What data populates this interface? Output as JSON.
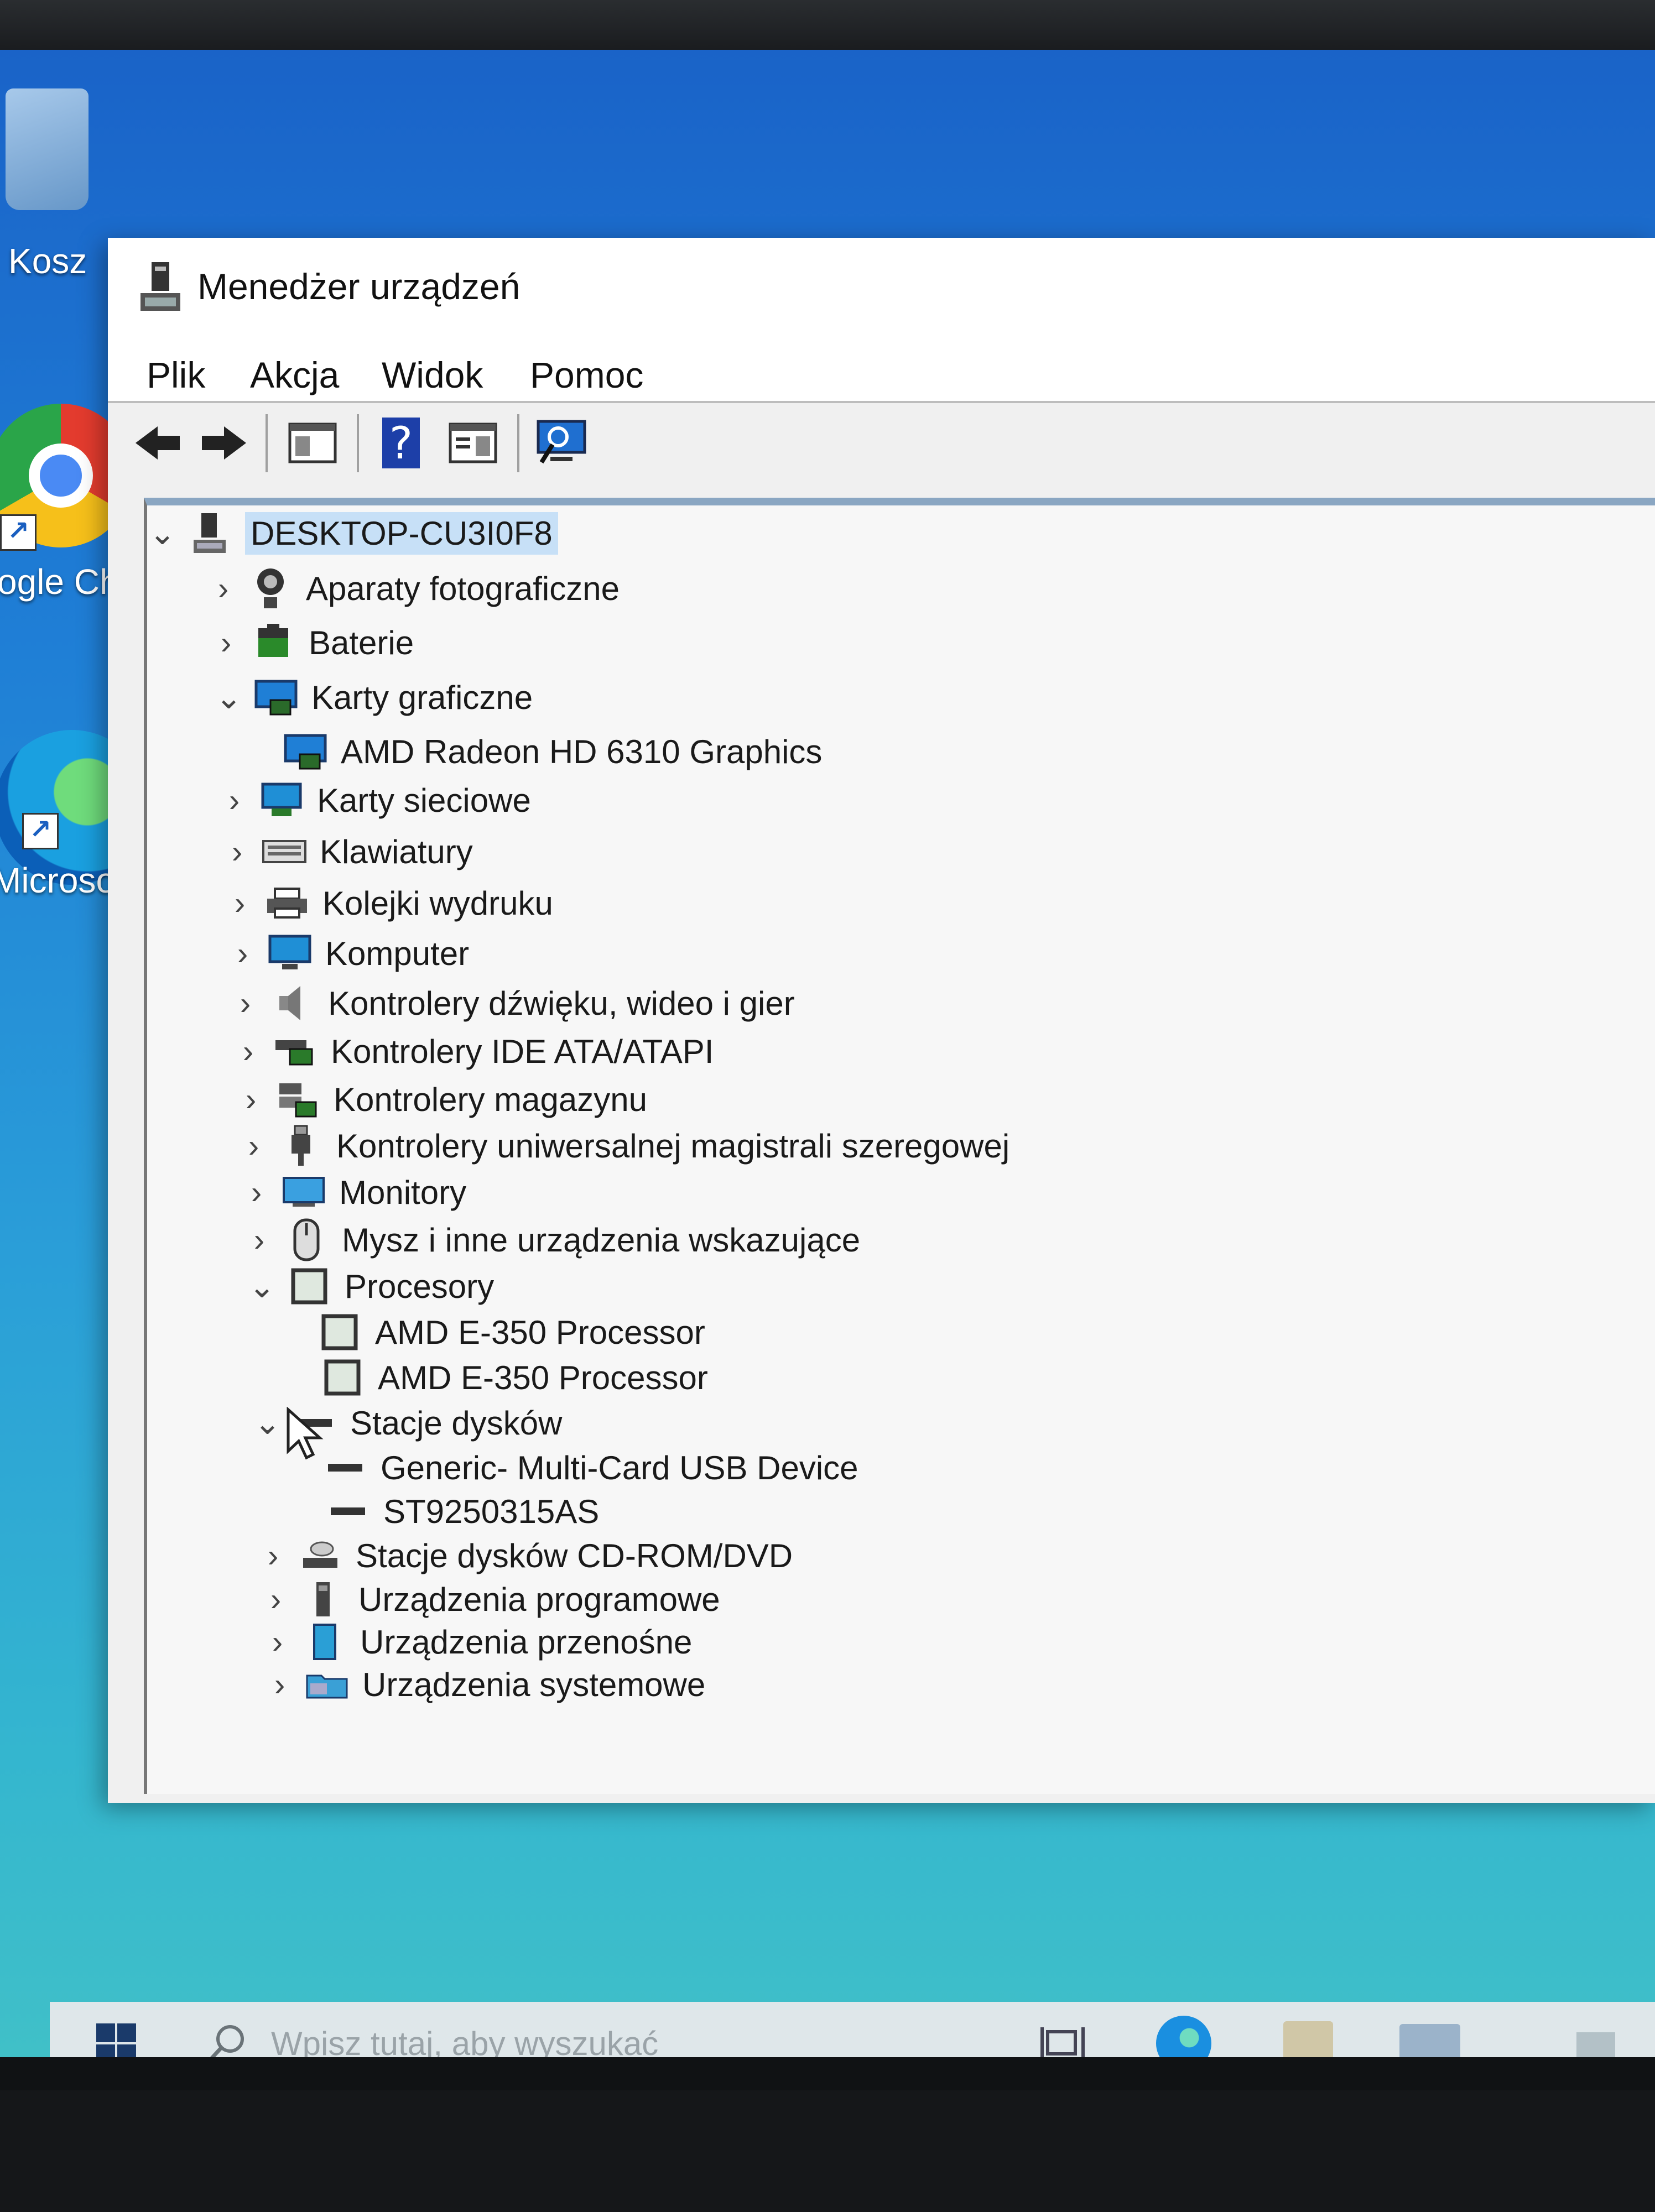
{
  "desktop": {
    "icons": [
      {
        "label": "Kosz"
      },
      {
        "label": "ogle Chro"
      },
      {
        "label": "Microsoft Ed"
      }
    ]
  },
  "window": {
    "title": "Menedżer urządzeń",
    "menu": [
      "Plik",
      "Akcja",
      "Widok",
      "Pomoc"
    ],
    "tree": {
      "root": "DESKTOP-CU3I0F8",
      "items": [
        {
          "label": "Aparaty fotograficzne",
          "expanded": false,
          "icon": "camera-icon"
        },
        {
          "label": "Baterie",
          "expanded": false,
          "icon": "battery-icon"
        },
        {
          "label": "Karty graficzne",
          "expanded": true,
          "icon": "display-adapter-icon"
        },
        {
          "label": "AMD Radeon HD 6310 Graphics",
          "child": true,
          "icon": "display-adapter-icon"
        },
        {
          "label": "Karty sieciowe",
          "expanded": false,
          "icon": "network-adapter-icon"
        },
        {
          "label": "Klawiatury",
          "expanded": false,
          "icon": "keyboard-icon"
        },
        {
          "label": "Kolejki wydruku",
          "expanded": false,
          "icon": "printer-icon"
        },
        {
          "label": "Komputer",
          "expanded": false,
          "icon": "computer-icon"
        },
        {
          "label": "Kontrolery dźwięku, wideo i gier",
          "expanded": false,
          "icon": "speaker-icon"
        },
        {
          "label": "Kontrolery IDE ATA/ATAPI",
          "expanded": false,
          "icon": "ide-controller-icon"
        },
        {
          "label": "Kontrolery magazynu",
          "expanded": false,
          "icon": "storage-controller-icon"
        },
        {
          "label": "Kontrolery uniwersalnej magistrali szeregowej",
          "expanded": false,
          "icon": "usb-icon"
        },
        {
          "label": "Monitory",
          "expanded": false,
          "icon": "monitor-icon"
        },
        {
          "label": "Mysz i inne urządzenia wskazujące",
          "expanded": false,
          "icon": "mouse-icon"
        },
        {
          "label": "Procesory",
          "expanded": true,
          "icon": "processor-icon"
        },
        {
          "label": "AMD E-350 Processor",
          "child": true,
          "icon": "processor-icon"
        },
        {
          "label": "AMD E-350 Processor",
          "child": true,
          "icon": "processor-icon"
        },
        {
          "label": "Stacje dysków",
          "expanded": true,
          "icon": "disk-drive-icon"
        },
        {
          "label": "Generic- Multi-Card USB Device",
          "child": true,
          "icon": "disk-drive-icon"
        },
        {
          "label": "ST9250315AS",
          "child": true,
          "icon": "disk-drive-icon"
        },
        {
          "label": "Stacje dysków CD-ROM/DVD",
          "expanded": false,
          "icon": "cdrom-icon"
        },
        {
          "label": "Urządzenia programowe",
          "expanded": false,
          "icon": "software-device-icon"
        },
        {
          "label": "Urządzenia przenośne",
          "expanded": false,
          "icon": "portable-device-icon"
        },
        {
          "label": "Urządzenia systemowe",
          "expanded": false,
          "icon": "system-device-icon"
        }
      ]
    }
  },
  "taskbar": {
    "search_placeholder": "Wpisz tutaj, aby wyszukać"
  }
}
